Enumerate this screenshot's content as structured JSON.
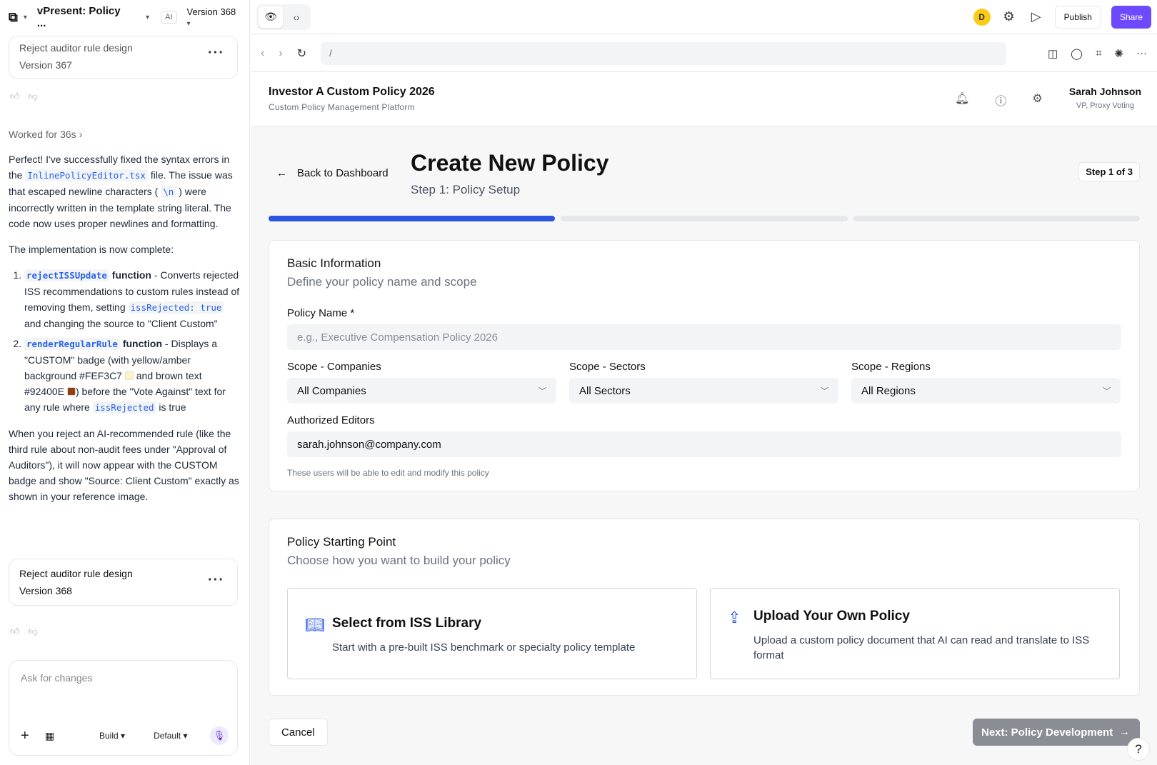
{
  "editor": {
    "project_title": "vPresent: Policy ...",
    "ai_badge": "AI",
    "version_select": "Version 368"
  },
  "chat": {
    "prev_version": {
      "title": "Reject auditor rule design",
      "version": "Version 367"
    },
    "worked_for": "Worked for 36s",
    "p1_a": "Perfect! I've successfully fixed the syntax errors in the ",
    "p1_code": "InlinePolicyEditor.tsx",
    "p1_b": " file. The issue was that escaped newline characters (",
    "p1_code2": "\\n",
    "p1_c": ") were incorrectly written in the template string literal. The code now uses proper newlines and formatting.",
    "p2": "The implementation is now complete:",
    "li1_code": "rejectISSUpdate",
    "li1_fn": " function",
    "li1_a": " - Converts rejected ISS recommendations to custom rules instead of removing them, setting ",
    "li1_code2": "issRejected: true",
    "li1_b": " and changing the source to \"Client Custom\"",
    "li2_code": "renderRegularRule",
    "li2_fn": " function",
    "li2_a": " - Displays a \"CUSTOM\" badge (with yellow/amber background #FEF3C7",
    "li2_b": " and brown text #92400E",
    "li2_c": ") before the \"Vote Against\" text for any rule where ",
    "li2_code2": "issRejected",
    "li2_d": " is true",
    "swatch1": "#FEF3C7",
    "swatch2": "#92400E",
    "p3": "When you reject an AI-recommended rule (like the third rule about non-audit fees under \"Approval of Auditors\"), it will now appear with the CUSTOM badge and show \"Source: Client Custom\" exactly as shown in your reference image.",
    "current_version": {
      "title": "Reject auditor rule design",
      "version": "Version 368"
    },
    "ask_placeholder": "Ask for changes",
    "build_label": "Build",
    "default_label": "Default"
  },
  "topbar": {
    "avatar_letter": "D",
    "publish": "Publish",
    "share": "Share",
    "accent": "#6d4aff"
  },
  "browser": {
    "url": "/"
  },
  "app": {
    "title": "Investor A Custom Policy 2026",
    "subtitle": "Custom Policy Management Platform",
    "user_name": "Sarah Johnson",
    "user_role": "VP, Proxy Voting",
    "back": "Back to Dashboard",
    "page_title": "Create New Policy",
    "page_step": "Step 1: Policy Setup",
    "step_badge": "Step 1 of 3",
    "basic": {
      "title": "Basic Information",
      "subtitle": "Define your policy name and scope",
      "policy_name_label": "Policy Name *",
      "policy_name_placeholder": "e.g., Executive Compensation Policy 2026",
      "scope_companies_label": "Scope - Companies",
      "scope_companies_value": "All Companies",
      "scope_sectors_label": "Scope - Sectors",
      "scope_sectors_value": "All Sectors",
      "scope_regions_label": "Scope - Regions",
      "scope_regions_value": "All Regions",
      "editors_label": "Authorized Editors",
      "editors_value": "sarah.johnson@company.com",
      "editors_hint": "These users will be able to edit and modify this policy"
    },
    "starting": {
      "title": "Policy Starting Point",
      "subtitle": "Choose how you want to build your policy",
      "opt1_title": "Select from ISS Library",
      "opt1_desc": "Start with a pre-built ISS benchmark or specialty policy template",
      "opt2_title": "Upload Your Own Policy",
      "opt2_desc": "Upload a custom policy document that AI can read and translate to ISS format"
    },
    "cancel": "Cancel",
    "next": "Next: Policy Development",
    "progress_color": "#2c56e0"
  }
}
